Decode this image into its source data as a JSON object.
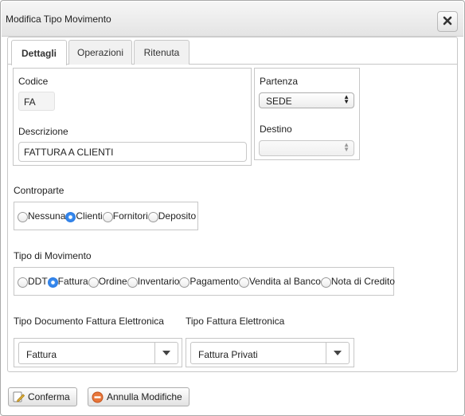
{
  "window": {
    "title": "Modifica Tipo Movimento"
  },
  "tabs": [
    {
      "label": "Dettagli",
      "active": true
    },
    {
      "label": "Operazioni",
      "active": false
    },
    {
      "label": "Ritenuta",
      "active": false
    }
  ],
  "details": {
    "codice_label": "Codice",
    "codice_value": "FA",
    "descrizione_label": "Descrizione",
    "descrizione_value": "FATTURA A CLIENTI",
    "partenza_label": "Partenza",
    "partenza_value": "SEDE",
    "destino_label": "Destino",
    "destino_value": ""
  },
  "controparte": {
    "label": "Controparte",
    "options": [
      "Nessuna",
      "Clienti",
      "Fornitori",
      "Deposito"
    ],
    "selected": "Clienti"
  },
  "tipo_movimento": {
    "label": "Tipo di Movimento",
    "options": [
      "DDT",
      "Fattura",
      "Ordine",
      "Inventario",
      "Pagamento",
      "Vendita al Banco",
      "Nota di Credito"
    ],
    "selected": "Fattura"
  },
  "fattura_elettronica": {
    "tipo_documento_label": "Tipo Documento Fattura Elettronica",
    "tipo_documento_value": "Fattura",
    "tipo_fattura_label": "Tipo Fattura Elettronica",
    "tipo_fattura_value": "Fattura Privati"
  },
  "buttons": {
    "confirm_label": "Conferma",
    "cancel_label": "Annulla Modifiche"
  },
  "icons": {
    "close": "close-icon",
    "confirm": "edit-document-icon",
    "cancel": "cancel-circle-icon",
    "dropdown": "chevron-down-icon"
  },
  "colors": {
    "radio_selected": "#2a76e0",
    "cancel_icon": "#e8763a",
    "confirm_icon": "#e3b43d"
  }
}
